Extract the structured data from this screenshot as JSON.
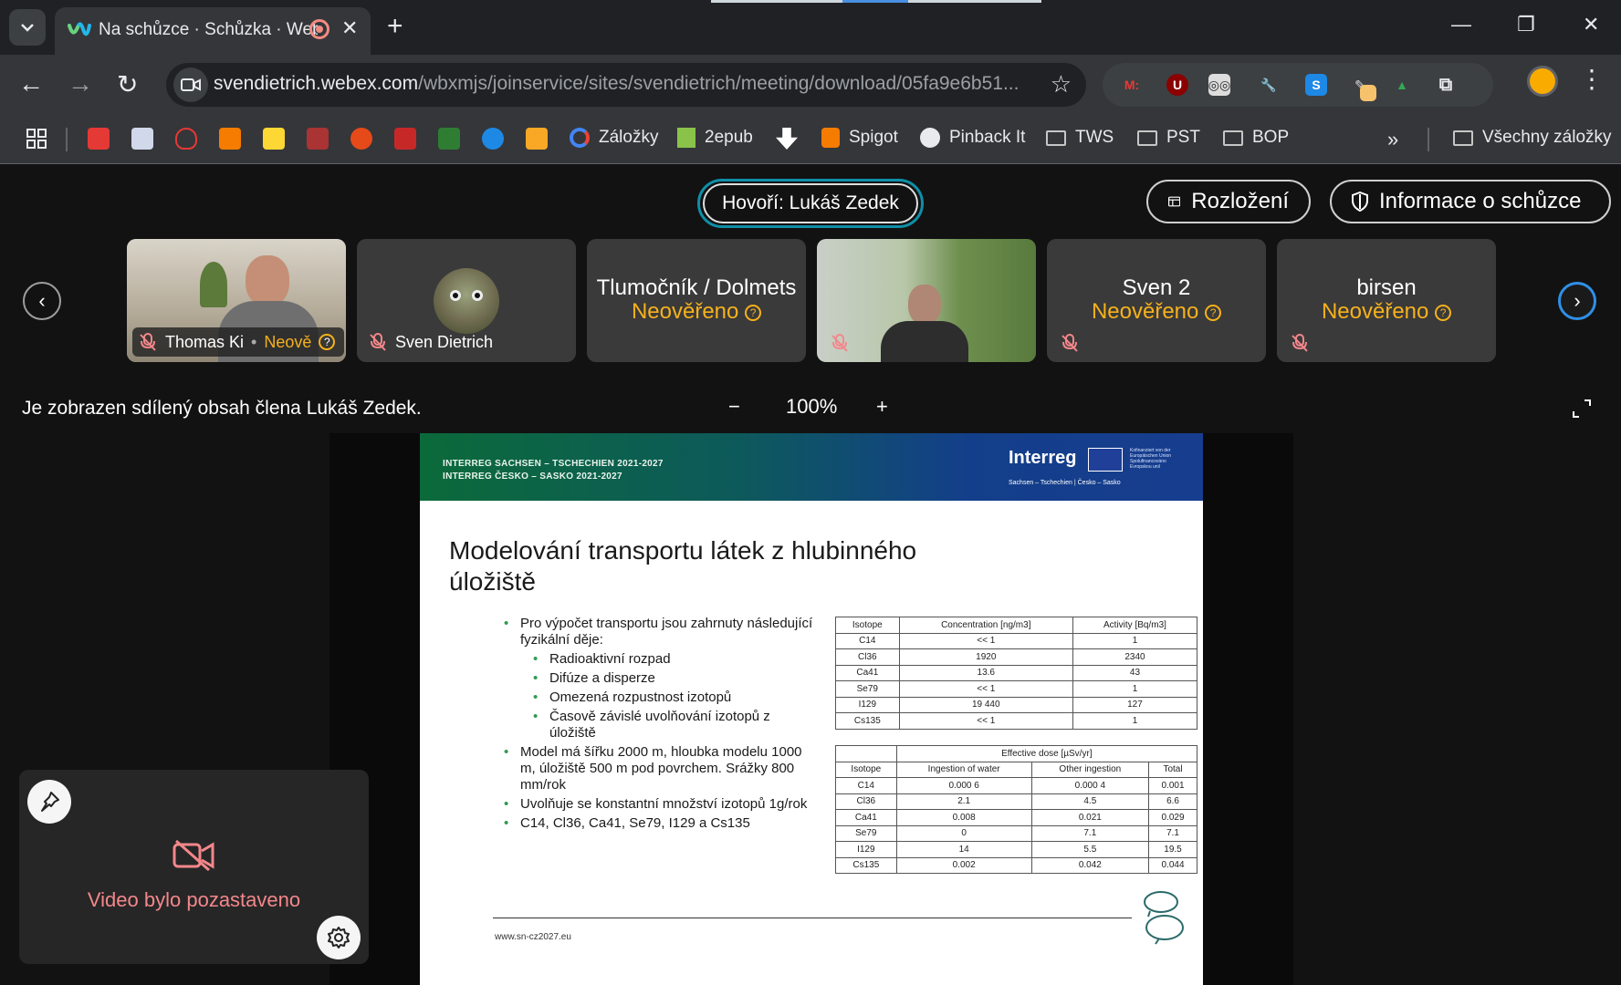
{
  "browser": {
    "tab_title": "Na schůzce · Schůzka · Webex",
    "url_host": "svendietrich.webex.com",
    "url_path": "/wbxmjs/joinservice/sites/svendietrich/meeting/download/05fa9e6b51...",
    "bookmarks": [
      {
        "label": "Záložky"
      },
      {
        "label": "2epub"
      },
      {
        "label": "Spigot"
      },
      {
        "label": "Pinback It"
      },
      {
        "label": "TWS"
      },
      {
        "label": "PST"
      },
      {
        "label": "BOP"
      }
    ],
    "all_bookmarks": "Všechny záložky",
    "more": "»"
  },
  "meeting": {
    "speaking": "Hovoří: Lukáš Zedek",
    "layout_button": "Rozložení",
    "info_button": "Informace o schůzce",
    "participants": [
      {
        "name": "Thomas Ki",
        "status": "Neově"
      },
      {
        "name": "Sven Dietrich"
      },
      {
        "name": "Tlumočník / Dolmets",
        "status": "Neověřeno"
      },
      {
        "name": ""
      },
      {
        "name": "Sven 2",
        "status": "Neověřeno"
      },
      {
        "name": "birsen",
        "status": "Neověřeno"
      }
    ],
    "share_info": "Je zobrazen sdílený obsah člena Lukáš Zedek.",
    "zoom_minus": "−",
    "zoom_level": "100%",
    "zoom_plus": "+",
    "self_view_status": "Video bylo pozastaveno"
  },
  "slide": {
    "header_line1": "INTERREG SACHSEN – TSCHECHIEN 2021-2027",
    "header_line2": "INTERREG ČESKO – SASKO 2021-2027",
    "brand": "Interreg",
    "eu_text": "Kofinanziert von der Europäischen Union Spolufinancováno Evropskou unií",
    "brand_sub": "Sachsen – Tschechien | Česko – Sasko",
    "title": "Modelování transportu látek z hlubinného úložiště",
    "bullet1": "Pro výpočet transportu jsou zahrnuty následující fyzikální děje:",
    "sub1": "Radioaktivní rozpad",
    "sub2": "Difúze a disperze",
    "sub3": "Omezená rozpustnost izotopů",
    "sub4": "Časově závislé uvolňování izotopů z úložiště",
    "bullet2": "Model má šířku 2000 m, hloubka modelu 1000 m, úložiště 500 m pod povrchem. Srážky 800 mm/rok",
    "bullet3": "Uvolňuje se konstantní množství izotopů 1g/rok",
    "bullet4": "C14, Cl36, Ca41, Se79, I129 a Cs135",
    "table1": {
      "headers": [
        "Isotope",
        "Concentration [ng/m3]",
        "Activity [Bq/m3]"
      ],
      "rows": [
        [
          "C14",
          "<< 1",
          "1"
        ],
        [
          "Cl36",
          "1920",
          "2340"
        ],
        [
          "Ca41",
          "13.6",
          "43"
        ],
        [
          "Se79",
          "<< 1",
          "1"
        ],
        [
          "I129",
          "19 440",
          "127"
        ],
        [
          "Cs135",
          "<< 1",
          "1"
        ]
      ]
    },
    "table2": {
      "group_header": "Effective dose [µSv/yr]",
      "headers": [
        "Isotope",
        "Ingestion of water",
        "Other ingestion",
        "Total"
      ],
      "rows": [
        [
          "C14",
          "0.000 6",
          "0.000 4",
          "0.001"
        ],
        [
          "Cl36",
          "2.1",
          "4.5",
          "6.6"
        ],
        [
          "Ca41",
          "0.008",
          "0.021",
          "0.029"
        ],
        [
          "Se79",
          "0",
          "7.1",
          "7.1"
        ],
        [
          "I129",
          "14",
          "5.5",
          "19.5"
        ],
        [
          "Cs135",
          "0.002",
          "0.042",
          "0.044"
        ]
      ]
    },
    "footer_url": "www.sn-cz2027.eu"
  }
}
